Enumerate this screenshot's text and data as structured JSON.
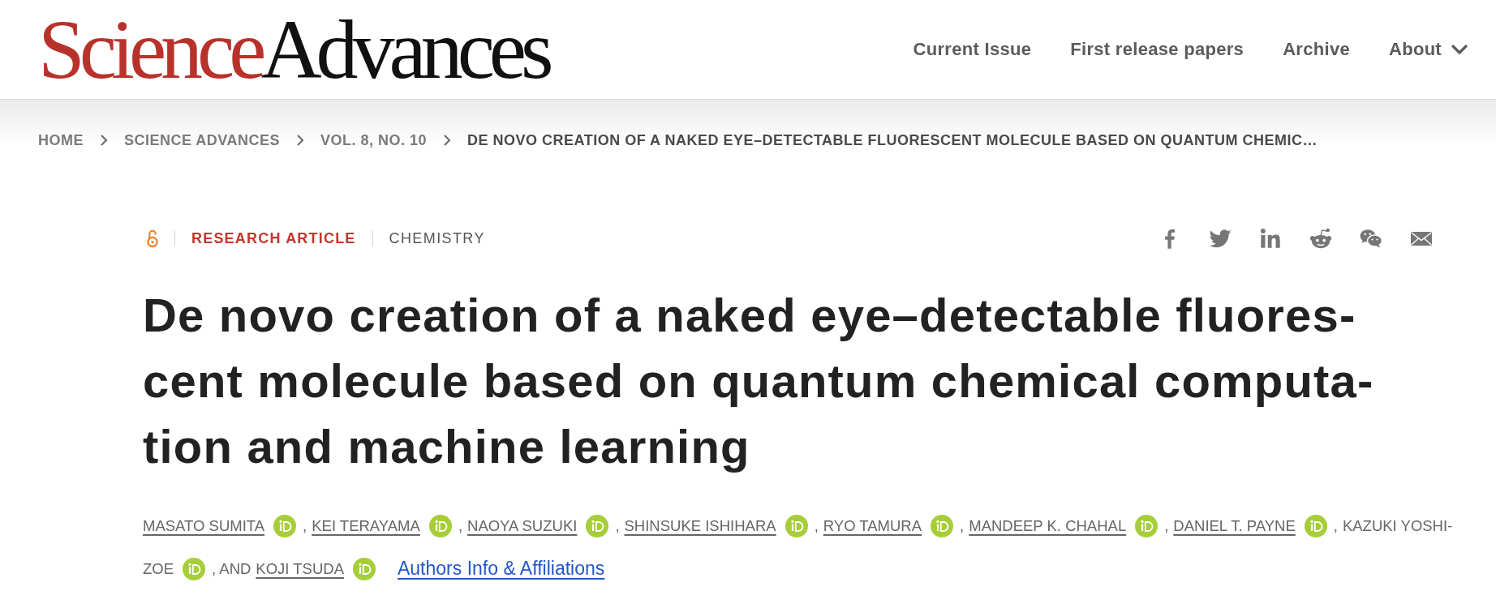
{
  "header": {
    "logo": {
      "first": "Science",
      "second": "Advances"
    },
    "nav": [
      {
        "label": "Current Issue",
        "kind": "link"
      },
      {
        "label": "First release papers",
        "kind": "link"
      },
      {
        "label": "Archive",
        "kind": "link"
      },
      {
        "label": "About",
        "kind": "menu"
      }
    ]
  },
  "breadcrumb": [
    {
      "label": "HOME",
      "current": false
    },
    {
      "label": "SCIENCE ADVANCES",
      "current": false
    },
    {
      "label": "VOL. 8, NO. 10",
      "current": false
    },
    {
      "label": "DE NOVO CREATION OF A NAKED EYE–DETECTABLE FLUORESCENT MOLECULE BASED ON QUANTUM CHEMIC…",
      "current": true
    }
  ],
  "article": {
    "open_access": true,
    "type": "RESEARCH ARTICLE",
    "subject": "CHEMISTRY",
    "title_lines": [
      "De novo creation of a naked eye–detectable fluores-",
      "cent molecule based on quantum chemical computa-",
      "tion and machine learning"
    ],
    "author_lines": [
      [
        {
          "kind": "name",
          "text": "MASATO SUMITA",
          "linked": true,
          "orcid": true
        },
        {
          "kind": "separator",
          "text": ","
        },
        {
          "kind": "name",
          "text": "KEI TERAYAMA",
          "linked": true,
          "orcid": true
        },
        {
          "kind": "separator",
          "text": ","
        },
        {
          "kind": "name",
          "text": "NAOYA SUZUKI",
          "linked": true,
          "orcid": true
        },
        {
          "kind": "separator",
          "text": ","
        },
        {
          "kind": "name",
          "text": "SHINSUKE ISHIHARA",
          "linked": true,
          "orcid": true
        },
        {
          "kind": "separator",
          "text": ","
        },
        {
          "kind": "name",
          "text": "RYO TAMURA",
          "linked": true,
          "orcid": true
        },
        {
          "kind": "separator",
          "text": ","
        },
        {
          "kind": "name",
          "text": "MANDEEP K. CHAHAL",
          "linked": true,
          "orcid": true
        },
        {
          "kind": "separator",
          "text": ","
        },
        {
          "kind": "name",
          "text": "DANIEL T. PAYNE",
          "linked": true,
          "orcid": true
        },
        {
          "kind": "separator",
          "text": ","
        },
        {
          "kind": "name",
          "text": "KAZUKI YOSHI-",
          "linked": false,
          "orcid": false
        }
      ],
      [
        {
          "kind": "name",
          "text": "ZOE",
          "linked": false,
          "orcid": true
        },
        {
          "kind": "separator",
          "text": ", AND"
        },
        {
          "kind": "name",
          "text": "KOJI TSUDA",
          "linked": true,
          "orcid": true
        }
      ]
    ],
    "authors_info_link": "Authors Info & Affiliations"
  }
}
